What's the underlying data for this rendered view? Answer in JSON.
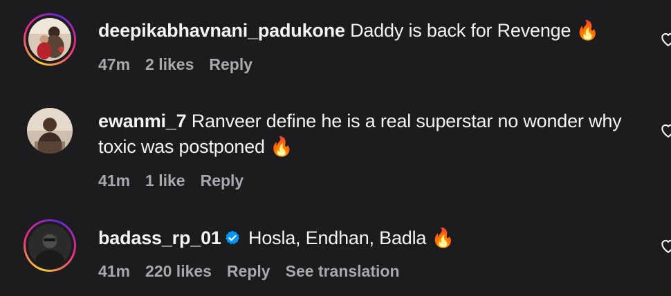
{
  "comments": [
    {
      "username": "deepikabhavnani_padukone",
      "text": "Daddy is back for Revenge 🔥",
      "time": "47m",
      "likes": "2 likes",
      "reply": "Reply",
      "translate": "",
      "avatar_ring": true,
      "verified": false
    },
    {
      "username": "ewanmi_7",
      "text": "Ranveer define he is a real superstar no wonder why toxic was postponed 🔥",
      "time": "41m",
      "likes": "1 like",
      "reply": "Reply",
      "translate": "",
      "avatar_ring": false,
      "verified": false
    },
    {
      "username": "badass_rp_01",
      "text": "Hosla, Endhan, Badla 🔥",
      "time": "41m",
      "likes": "220 likes",
      "reply": "Reply",
      "translate": "See translation",
      "avatar_ring": true,
      "verified": true
    }
  ],
  "colors": {
    "background": "#1c1c1f",
    "text": "#f2f2f3",
    "meta": "#a8a8ad",
    "verified": "#0095f6"
  }
}
